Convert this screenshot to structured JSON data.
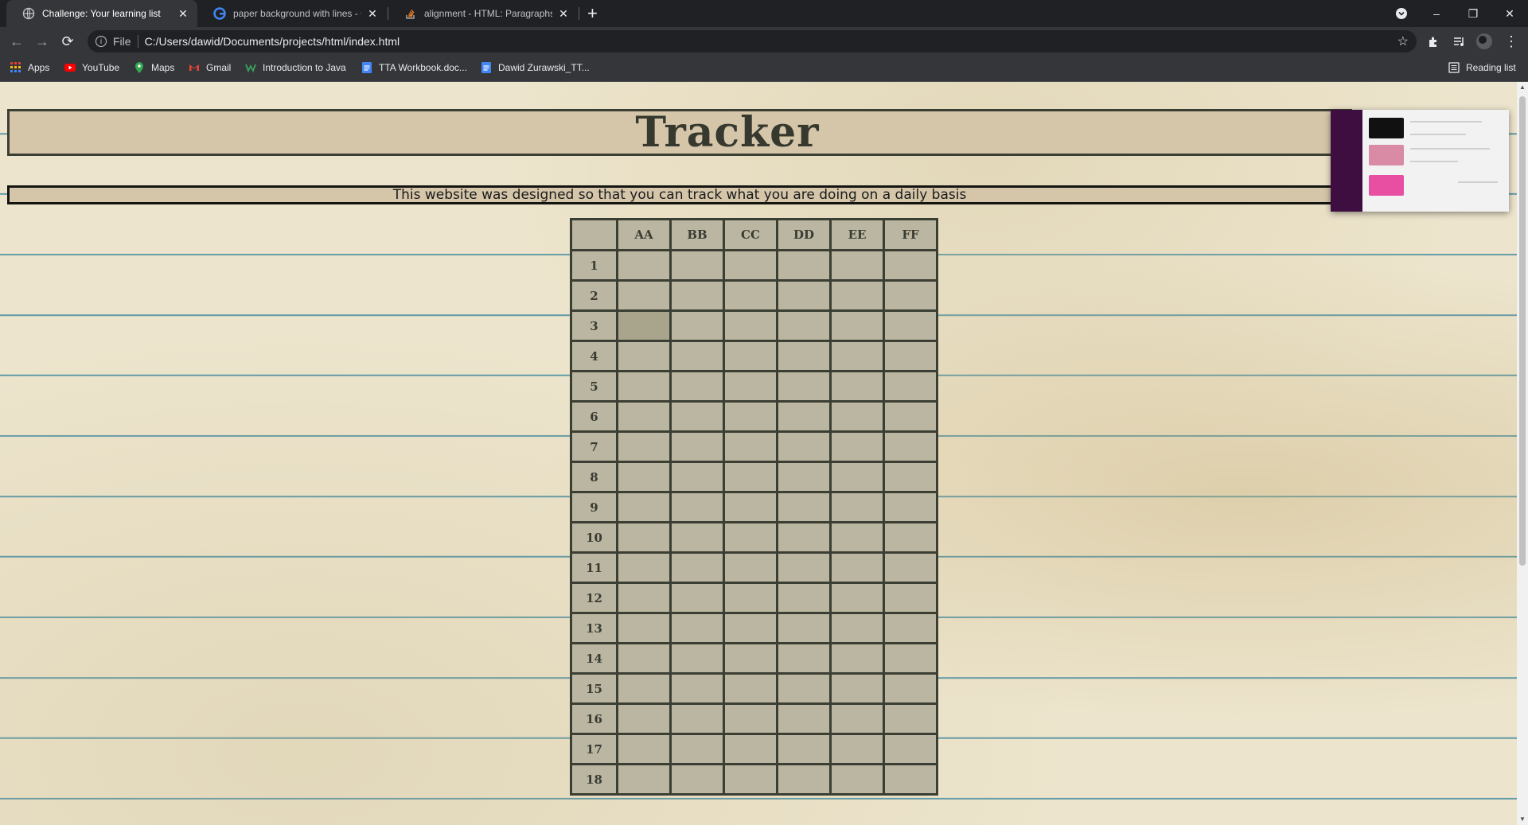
{
  "browser": {
    "tabs": [
      {
        "title": "Challenge: Your learning list",
        "active": true,
        "icon": "globe-icon"
      },
      {
        "title": "paper background with lines - Go",
        "active": false,
        "icon": "google-icon"
      },
      {
        "title": "alignment - HTML: Paragraphs al",
        "active": false,
        "icon": "stack-overflow-icon"
      }
    ],
    "new_tab": "+",
    "window_controls": {
      "minimize": "–",
      "restore": "❐",
      "close": "✕"
    },
    "address": {
      "scheme": "File",
      "url": "C:/Users/dawid/Documents/projects/html/index.html"
    },
    "bookmarks": [
      {
        "label": "Apps",
        "icon": "apps-grid-icon",
        "color": "#e94235"
      },
      {
        "label": "YouTube",
        "icon": "youtube-icon",
        "color": "#ff0000"
      },
      {
        "label": "Maps",
        "icon": "maps-pin-icon",
        "color": "#34a853"
      },
      {
        "label": "Gmail",
        "icon": "gmail-icon",
        "color": "#ea4335"
      },
      {
        "label": "Introduction to Java",
        "icon": "w-icon",
        "color": "#3aa35c"
      },
      {
        "label": "TTA Workbook.doc...",
        "icon": "docs-icon",
        "color": "#4285f4"
      },
      {
        "label": "Dawid Zurawski_TT...",
        "icon": "docs-icon",
        "color": "#4285f4"
      }
    ],
    "reading_list": "Reading list"
  },
  "page": {
    "title": "Tracker",
    "subtitle": "This website was designed so that you can track what you are doing on a daily basis",
    "table": {
      "columns": [
        "",
        "AA",
        "BB",
        "CC",
        "DD",
        "EE",
        "FF"
      ],
      "rows": [
        "1",
        "2",
        "3",
        "4",
        "5",
        "6",
        "7",
        "8",
        "9",
        "10",
        "11",
        "12",
        "13",
        "14",
        "15",
        "16",
        "17",
        "18"
      ]
    }
  },
  "colors": {
    "header_bg": "#d5c6aa",
    "table_bg": "#bab6a1",
    "border": "#3b3e33",
    "paper": "#ece4cc",
    "rule_line": "#468ca0"
  }
}
